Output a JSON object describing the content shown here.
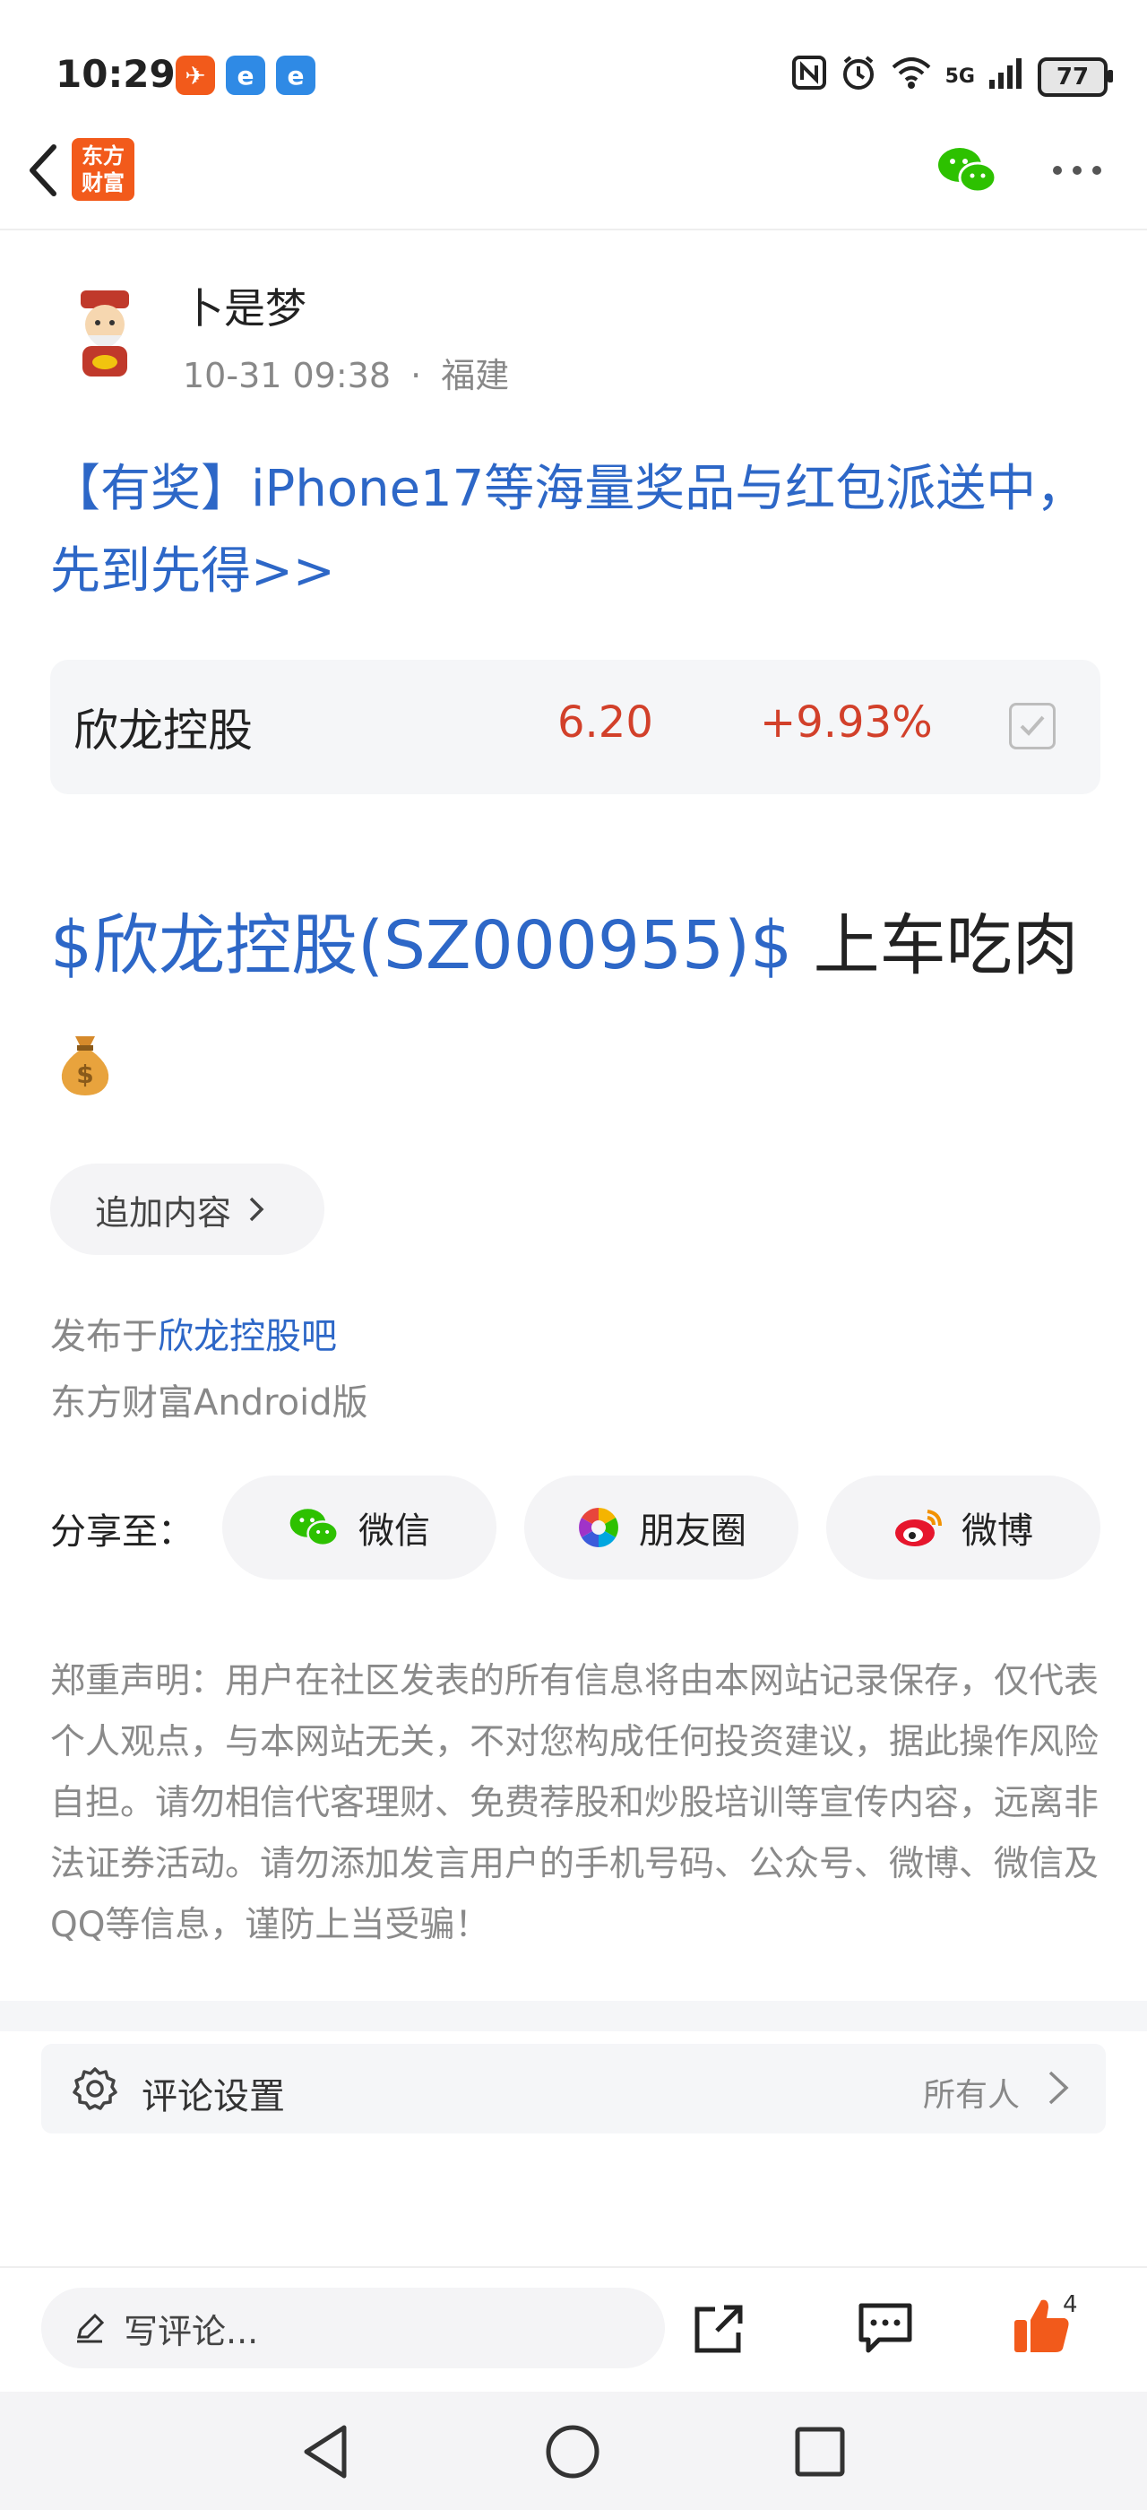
{
  "status_bar": {
    "time": "10:29",
    "network": "5G",
    "signal_label": "6",
    "battery": "77"
  },
  "nav": {
    "logo_line1": "东方",
    "logo_line2": "财富"
  },
  "author": {
    "name": "卜是梦",
    "time": "10-31 09:38",
    "separator": "·",
    "location": "福建"
  },
  "promo": {
    "text": "【有奖】iPhone17等海量奖品与红包派送中，先到先得>>"
  },
  "stock": {
    "name": "欣龙控股",
    "price": "6.20",
    "change": "+9.93%"
  },
  "post": {
    "link": "$欣龙控股(SZ000955)$",
    "text": " 上车吃肉"
  },
  "add_content": {
    "label": "追加内容"
  },
  "publish": {
    "prefix": "发布于",
    "board": "欣龙控股吧",
    "client": "东方财富Android版"
  },
  "share": {
    "label": "分享至：",
    "targets": [
      {
        "label": "微信"
      },
      {
        "label": "朋友圈"
      },
      {
        "label": "微博"
      }
    ]
  },
  "disclaimer": "郑重声明：用户在社区发表的所有信息将由本网站记录保存，仅代表个人观点，与本网站无关，不对您构成任何投资建议，据此操作风险自担。请勿相信代客理财、免费荐股和炒股培训等宣传内容，远离非法证券活动。请勿添加发言用户的手机号码、公众号、微博、微信及QQ等信息，谨防上当受骗！",
  "comment_settings": {
    "label": "评论设置",
    "value": "所有人"
  },
  "bottom_bar": {
    "comment_placeholder": "写评论...",
    "like_count": "4"
  },
  "colors": {
    "brand": "#f25a1b",
    "link": "#2d67c7",
    "rise": "#d2402a",
    "wechat": "#2dc100"
  }
}
